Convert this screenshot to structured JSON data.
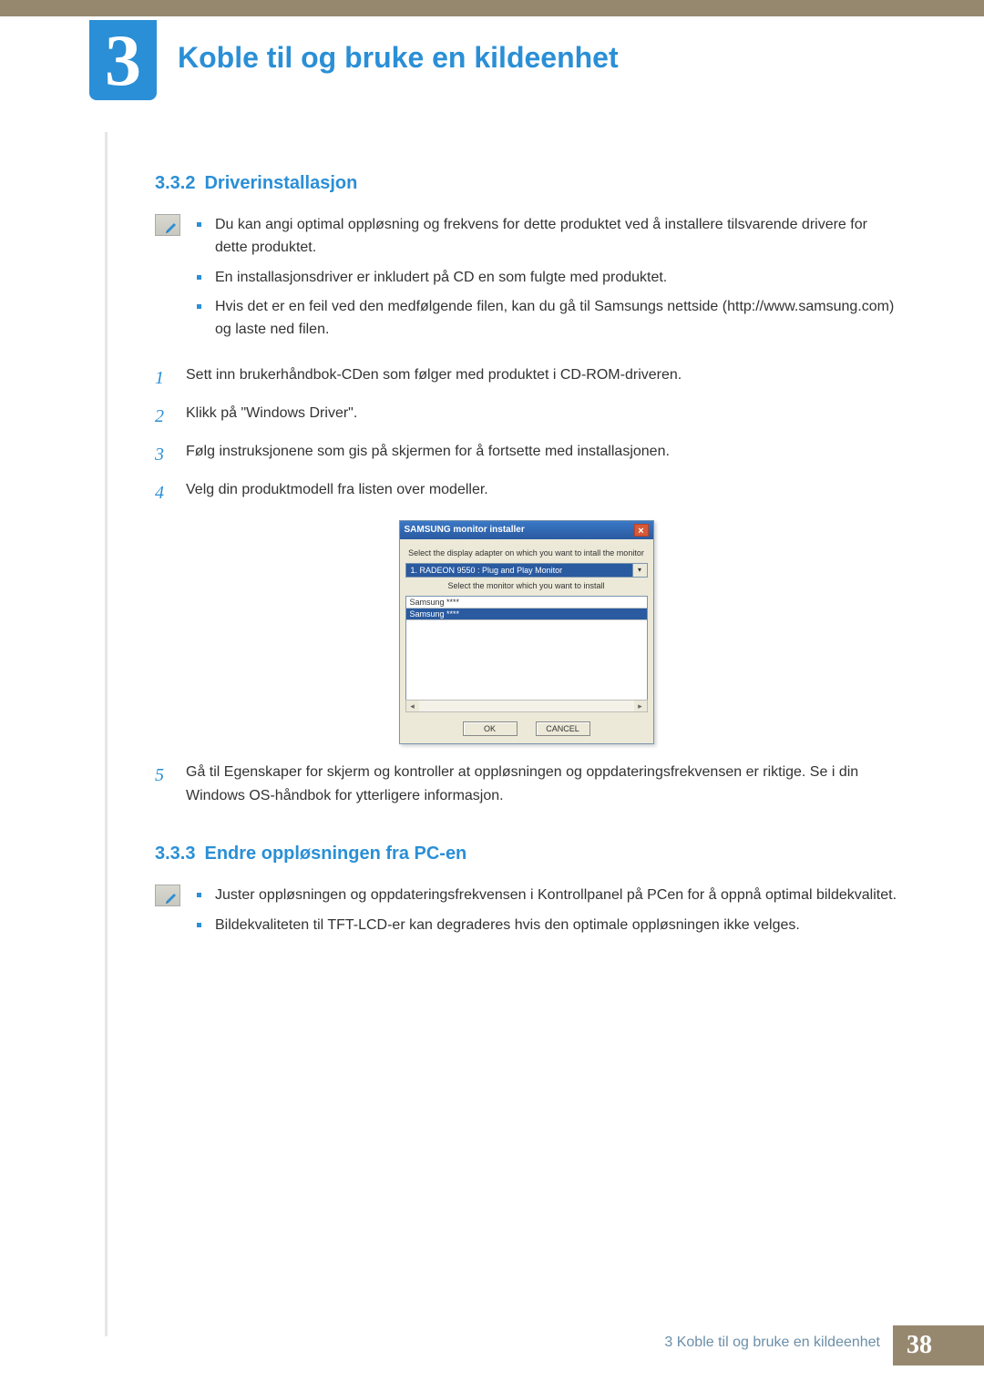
{
  "chapter": {
    "number": "3",
    "title": "Koble til og bruke en kildeenhet"
  },
  "section1": {
    "number": "3.3.2",
    "title": "Driverinstallasjon",
    "notes": [
      "Du kan angi optimal oppløsning og frekvens for dette produktet ved å installere tilsvarende drivere for dette produktet.",
      "En installasjonsdriver er inkludert på CD en som fulgte med produktet.",
      "Hvis det er en feil ved den medfølgende filen, kan du gå til Samsungs nettside (http://www.samsung.com) og laste ned filen."
    ],
    "steps": [
      "Sett inn brukerhåndbok-CDen som følger med produktet i CD-ROM-driveren.",
      "Klikk på \"Windows Driver\".",
      "Følg instruksjonene som gis på skjermen for å fortsette med installasjonen.",
      "Velg din produktmodell fra listen over modeller."
    ],
    "step5": "Gå til Egenskaper for skjerm og kontroller at oppløsningen og oppdateringsfrekvensen er riktige. Se i din Windows OS-håndbok for ytterligere informasjon."
  },
  "installer": {
    "title": "SAMSUNG monitor installer",
    "label1": "Select the display adapter on which you want to intall the monitor",
    "dropdown": "1. RADEON 9550 : Plug and Play Monitor",
    "label2": "Select the monitor which you want to install",
    "list": [
      "Samsung ****",
      "Samsung ****"
    ],
    "ok": "OK",
    "cancel": "CANCEL"
  },
  "section2": {
    "number": "3.3.3",
    "title": "Endre oppløsningen fra PC-en",
    "notes": [
      "Juster oppløsningen og oppdateringsfrekvensen i Kontrollpanel på PCen for å oppnå optimal bildekvalitet.",
      "Bildekvaliteten til TFT-LCD-er kan degraderes hvis den optimale oppløsningen ikke velges."
    ]
  },
  "footer": {
    "text": "3 Koble til og bruke en kildeenhet",
    "page": "38"
  }
}
